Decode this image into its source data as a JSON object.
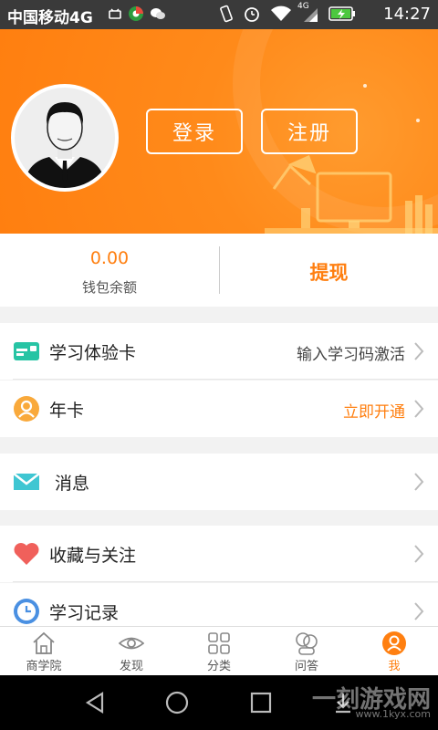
{
  "status_bar": {
    "carrier": "中国移动4G",
    "time": "14:27",
    "network_tag": "4G"
  },
  "header": {
    "login_label": "登录",
    "register_label": "注册"
  },
  "wallet": {
    "balance": "0.00",
    "balance_label": "钱包余额",
    "withdraw_label": "提现"
  },
  "menu": {
    "study_card": {
      "label": "学习体验卡",
      "action": "输入学习码激活"
    },
    "annual_card": {
      "label": "年卡",
      "action": "立即开通"
    },
    "messages": {
      "label": "消息"
    },
    "favorites": {
      "label": "收藏与关注"
    },
    "history": {
      "label": "学习记录"
    }
  },
  "tabs": [
    {
      "label": "商学院",
      "icon": "home-icon"
    },
    {
      "label": "发现",
      "icon": "eye-icon"
    },
    {
      "label": "分类",
      "icon": "grid-icon"
    },
    {
      "label": "问答",
      "icon": "chat-icon"
    },
    {
      "label": "我",
      "icon": "user-icon"
    }
  ],
  "watermark": {
    "title": "一刻游戏网",
    "url": "www.1kyx.com"
  },
  "colors": {
    "accent": "#ff7f10",
    "status_bar": "#3a3a3a"
  }
}
